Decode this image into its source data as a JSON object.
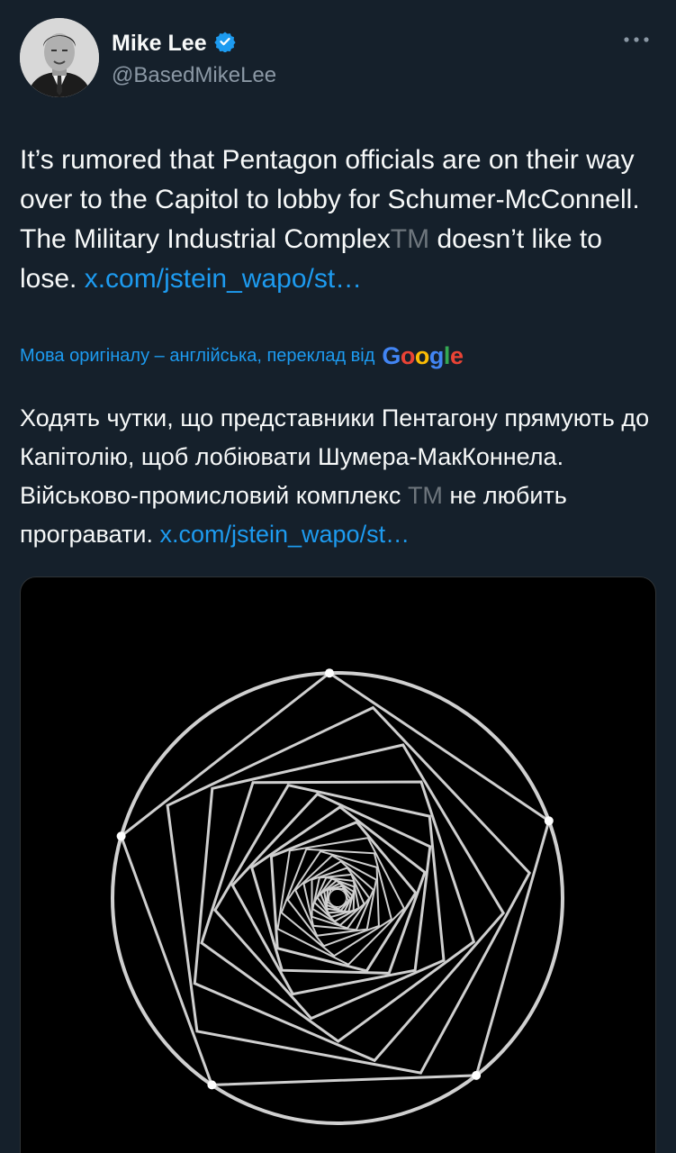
{
  "author": {
    "display_name": "Mike Lee",
    "handle": "@BasedMikeLee",
    "verified_icon": "verified-badge-icon",
    "more_icon": "more-options-icon"
  },
  "tweet": {
    "text_part1": "It’s rumored that Pentagon officials are on their way over to the Capitol to lobby for Schumer-McConnell. The Military Industrial Complex",
    "tm": "TM",
    "text_part2": "doesn’t like to lose.",
    "link": "x.com/jstein_wapo/st…"
  },
  "translation": {
    "notice": "Мова оригіналу – англійська, переклад від",
    "provider": "Google",
    "text_part1": "Ходять чутки, що представники Пентагону прямують до Капітолію, щоб лобіювати Шумера-МакКоннела. Військово-промисловий комплекс",
    "tm": "TM",
    "text_part2": "не любить програвати.",
    "link": "x.com/jstein_wapo/st…"
  },
  "colors": {
    "background": "#15202b",
    "text": "#f7f9f9",
    "secondary": "#8b98a5",
    "link": "#1d9bf0",
    "verified": "#1d9bf0"
  }
}
